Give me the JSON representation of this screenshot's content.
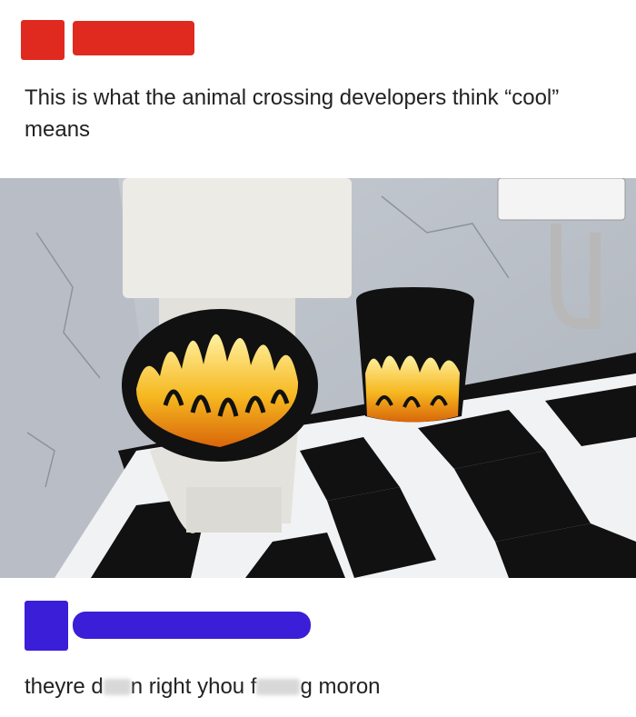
{
  "post": {
    "caption": "This is what the animal crossing developers think “cool” means",
    "image_subject": "flame-icon"
  },
  "reply": {
    "part1": "theyre d",
    "part2": "n right yhou f",
    "part3": "g moron"
  },
  "colors": {
    "op_redaction": "#e0291f",
    "replier_redaction": "#3a1ed8"
  }
}
